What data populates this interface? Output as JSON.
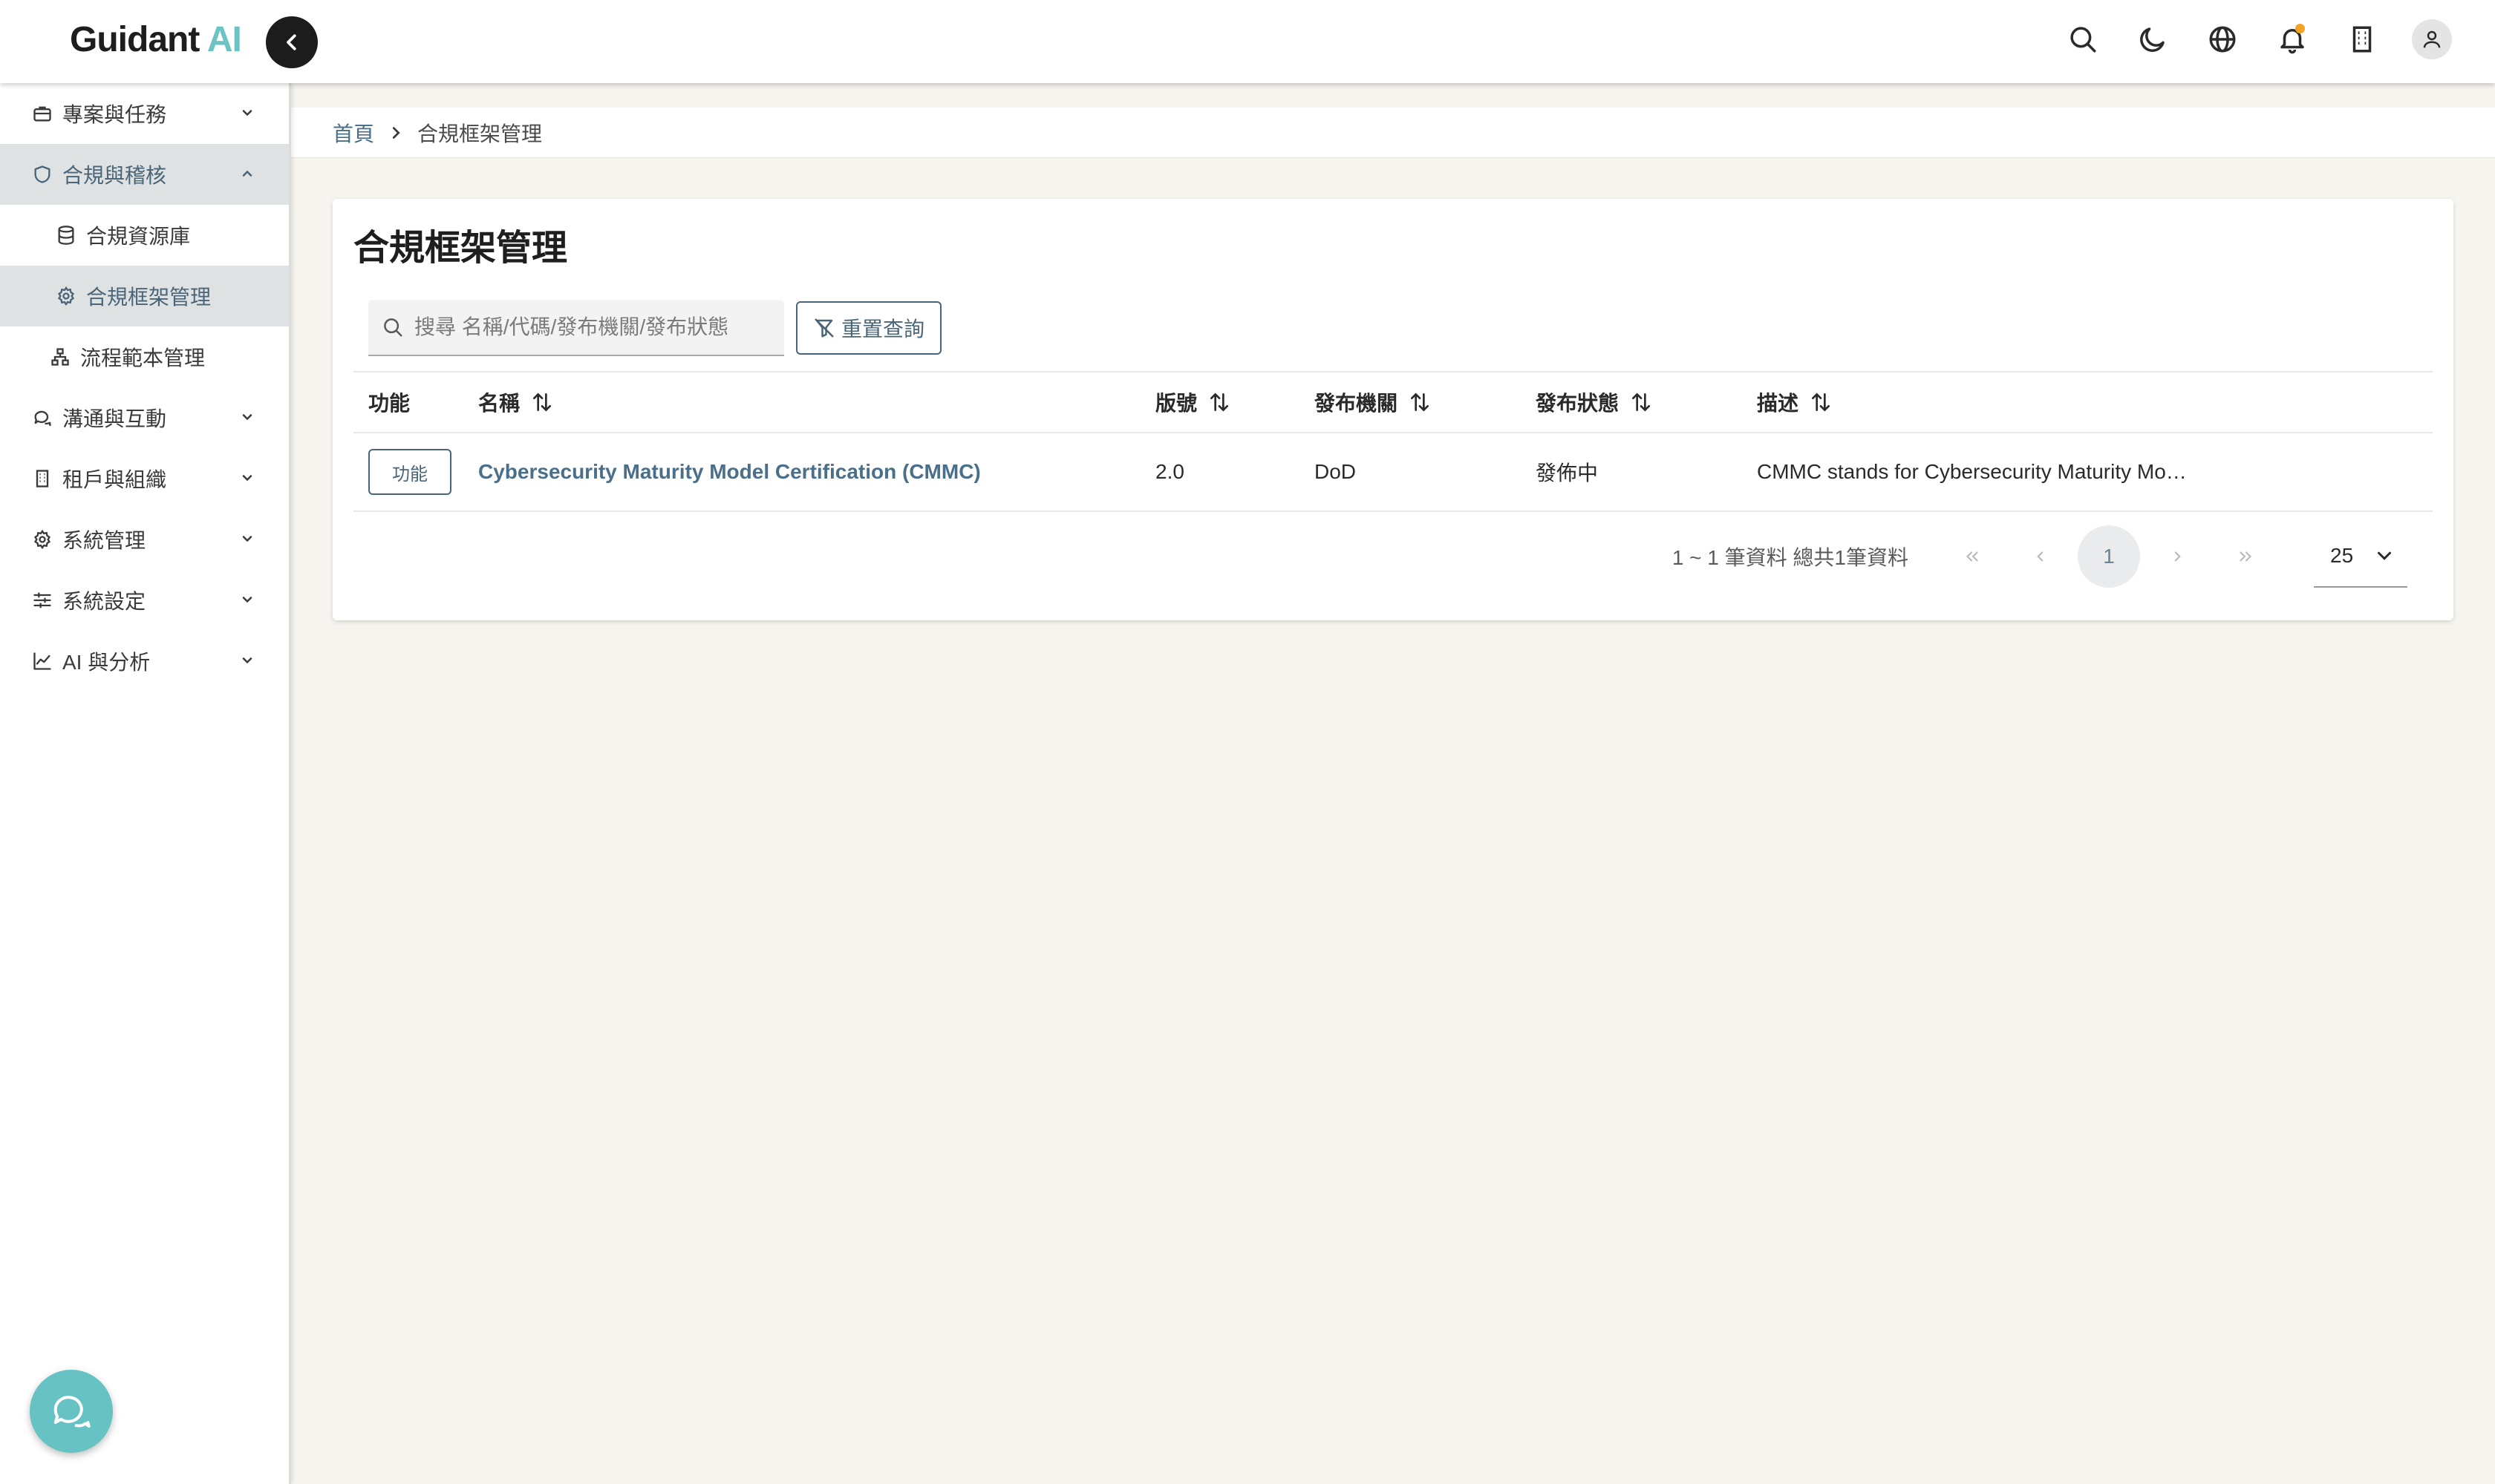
{
  "app": {
    "brand_main": "Guidant",
    "brand_accent": "AI",
    "accent_color": "#6cc3c4",
    "primary_color": "#4a6578"
  },
  "topbar": {
    "icons": [
      "search-icon",
      "moon-icon",
      "globe-icon",
      "bell-icon",
      "building-icon",
      "user-icon"
    ],
    "has_notification": true
  },
  "sidebar": {
    "items": [
      {
        "label": "專案與任務",
        "icon": "briefcase-icon",
        "expanded": false
      },
      {
        "label": "合規與稽核",
        "icon": "shield-icon",
        "expanded": true,
        "children": [
          {
            "label": "合規資源庫",
            "icon": "database-icon",
            "active": false
          },
          {
            "label": "合規框架管理",
            "icon": "gear-icon",
            "active": true
          },
          {
            "label": "流程範本管理",
            "icon": "hierarchy-icon",
            "active": false
          }
        ]
      },
      {
        "label": "溝通與互動",
        "icon": "chat-icon",
        "expanded": false
      },
      {
        "label": "租戶與組織",
        "icon": "building-icon",
        "expanded": false
      },
      {
        "label": "系統管理",
        "icon": "gear-icon",
        "expanded": false
      },
      {
        "label": "系統設定",
        "icon": "sliders-icon",
        "expanded": false
      },
      {
        "label": "AI 與分析",
        "icon": "chart-icon",
        "expanded": false
      }
    ]
  },
  "breadcrumb": {
    "home": "首頁",
    "current": "合規框架管理"
  },
  "page": {
    "title": "合規框架管理",
    "search": {
      "placeholder": "搜尋 名稱/代碼/發布機關/發布狀態",
      "value": ""
    },
    "reset_label": "重置查詢"
  },
  "table": {
    "columns": [
      "功能",
      "名稱",
      "版號",
      "發布機關",
      "發布狀態",
      "描述"
    ],
    "rows": [
      {
        "action_label": "功能",
        "name": "Cybersecurity Maturity Model Certification (CMMC)",
        "version": "2.0",
        "publisher": "DoD",
        "status": "發佈中",
        "description": "CMMC stands for Cybersecurity Maturity Mod…"
      }
    ]
  },
  "pagination": {
    "info": "1 ~ 1 筆資料 總共1筆資料",
    "current_page": "1",
    "page_size": "25"
  }
}
